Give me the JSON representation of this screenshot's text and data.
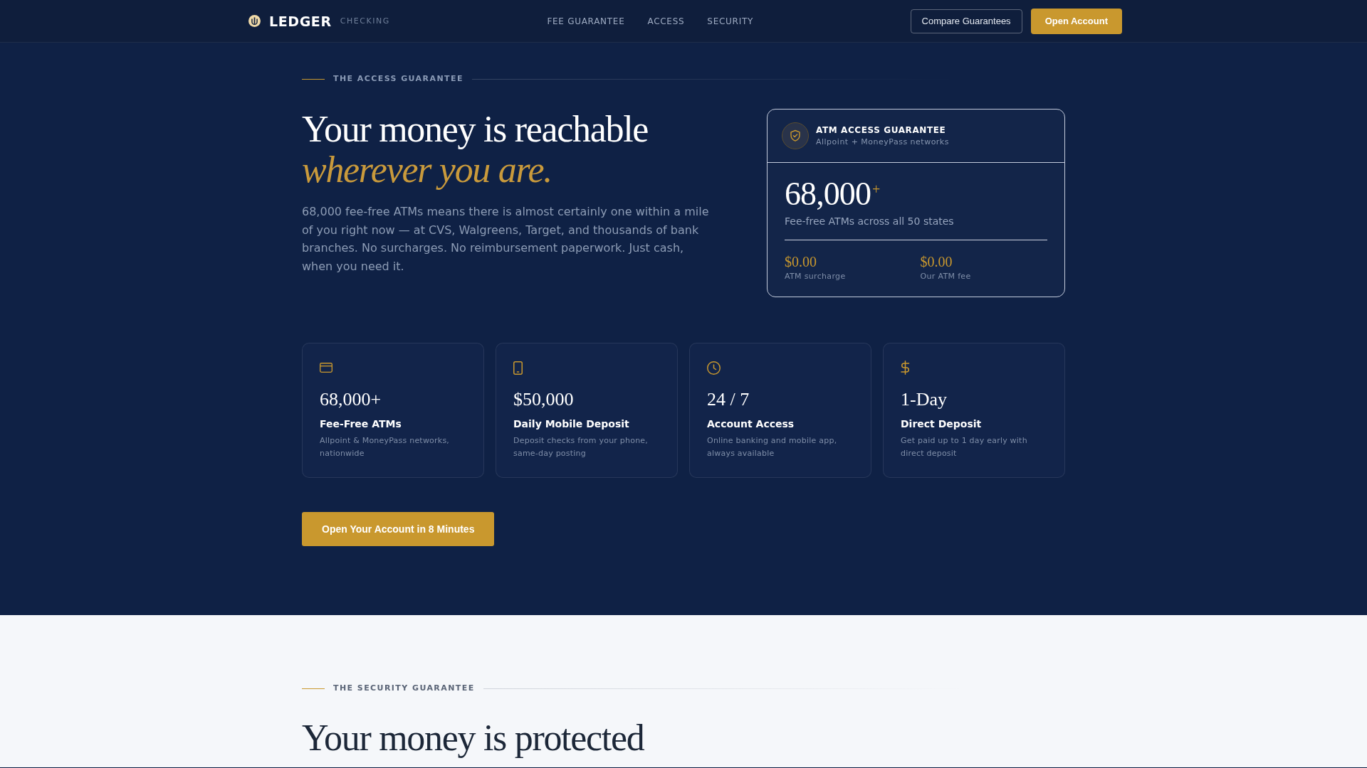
{
  "header": {
    "brand": "LEDGER",
    "product": "CHECKING",
    "nav": [
      {
        "label": "FEE GUARANTEE"
      },
      {
        "label": "ACCESS"
      },
      {
        "label": "SECURITY"
      }
    ],
    "actions": [
      {
        "label": "Compare Guarantees",
        "kind": "outline"
      },
      {
        "label": "Open Account",
        "kind": "primary"
      }
    ]
  },
  "access_section": {
    "eyebrow": "THE ACCESS GUARANTEE",
    "headline": "Your money is reachable *wherever you are.*",
    "description": "68,000 fee-free ATMs means there is almost certainly one within a mile of you right now — at CVS, Walgreens, Target, and thousands of bank branches. No surcharges. No reimbursement paperwork. Just cash, when you need it.",
    "atm_card": {
      "title": "ATM ACCESS GUARANTEE",
      "subtitle": "Allpoint + MoneyPass networks",
      "figure": "68,000$^{+}$",
      "caption": "Fee-free ATMs across all 50 states",
      "fees": [
        {
          "amount": "$0.00",
          "label": "ATM surcharge"
        },
        {
          "amount": "$0.00",
          "label": "Our ATM fee"
        }
      ]
    },
    "features": [
      {
        "figure": "68,000+",
        "title": "Fee-Free ATMs",
        "description": "Allpoint & MoneyPass networks, nationwide"
      },
      {
        "figure": "$50,000",
        "title": "Daily Mobile Deposit",
        "description": "Deposit checks from your phone, same-day posting"
      },
      {
        "figure": "24 / 7",
        "title": "Account Access",
        "description": "Online banking and mobile app, always available"
      },
      {
        "figure": "1-Day",
        "title": "Direct Deposit",
        "description": "Get paid up to 1 day early with direct deposit"
      }
    ],
    "cta": "Open Your Account in 8 Minutes"
  },
  "security_section": {
    "eyebrow": "THE SECURITY GUARANTEE",
    "headline": "Your money is protected"
  }
}
